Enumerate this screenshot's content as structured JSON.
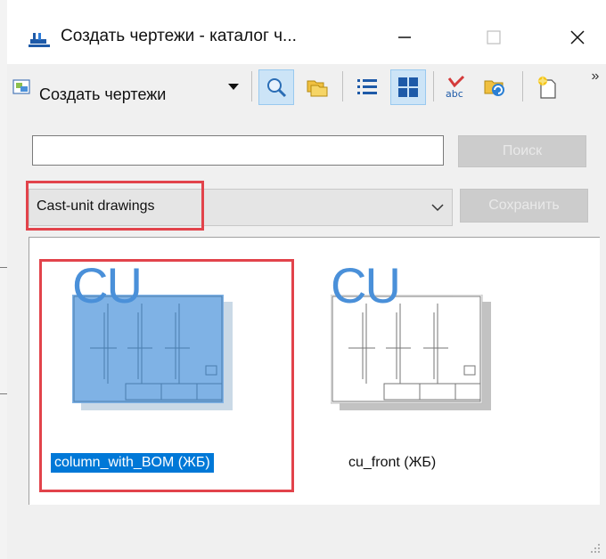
{
  "window": {
    "title": "Создать чертежи - каталог ч...",
    "minimize_icon": "minimize-icon",
    "maximize_icon": "maximize-icon",
    "close_icon": "close-icon"
  },
  "toolbar": {
    "drawings_button_label": "Создать чертежи",
    "overflow": "»",
    "tools": [
      "search-icon",
      "folders-icon",
      "list-view-icon",
      "thumbnail-view-icon",
      "spellcheck-icon",
      "refresh-icon",
      "new-icon"
    ],
    "active_tools": [
      "search-icon",
      "thumbnail-view-icon"
    ]
  },
  "search": {
    "value": "",
    "button_label": "Поиск"
  },
  "filter": {
    "selected": "Cast-unit drawings",
    "save_label": "Сохранить"
  },
  "gallery": {
    "items": [
      {
        "badge": "CU",
        "label": "column_with_BOM (ЖБ)",
        "selected": true
      },
      {
        "badge": "CU",
        "label": "cu_front (ЖБ)",
        "selected": false
      }
    ]
  },
  "colors": {
    "selection": "#0078d7",
    "highlight_box": "#e2434b",
    "cu_badge": "#4a90d9",
    "disabled_button": "#cccccc"
  }
}
